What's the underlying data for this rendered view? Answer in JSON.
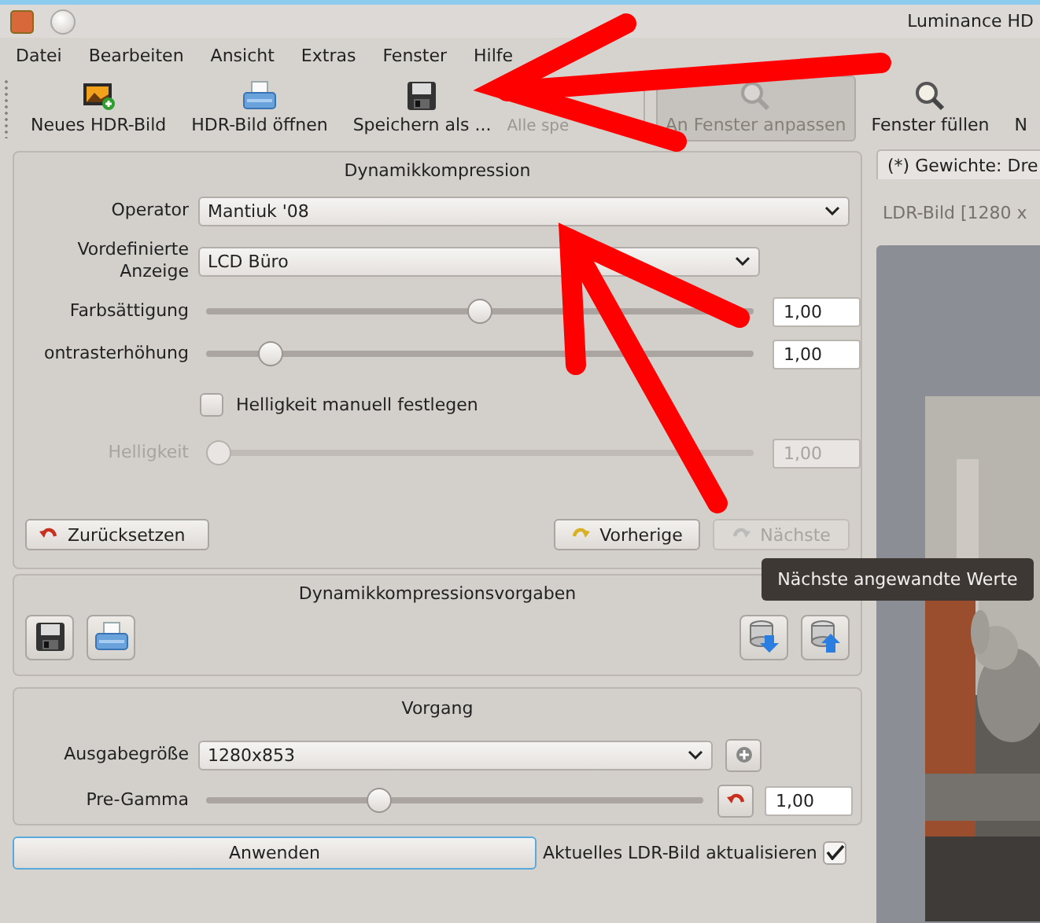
{
  "window": {
    "title": "Luminance HD"
  },
  "menu": [
    "Datei",
    "Bearbeiten",
    "Ansicht",
    "Extras",
    "Fenster",
    "Hilfe"
  ],
  "toolbar": [
    {
      "kind": "new-image",
      "label": "Neues HDR-Bild",
      "disabled": false,
      "selected": false
    },
    {
      "kind": "open",
      "label": "HDR-Bild öffnen",
      "disabled": false,
      "selected": false
    },
    {
      "kind": "save",
      "label": "Speichern als ...",
      "disabled": false,
      "selected": false
    },
    {
      "kind": "save-all",
      "label": "Alle spe",
      "disabled": true,
      "selected": false
    },
    {
      "kind": "fit",
      "label": "An Fenster anpassen",
      "disabled": true,
      "selected": true
    },
    {
      "kind": "fill",
      "label": "Fenster füllen",
      "disabled": false,
      "selected": false
    },
    {
      "kind": "text",
      "label": "N",
      "disabled": false,
      "selected": false
    }
  ],
  "tone_mapping": {
    "title": "Dynamikkompression",
    "operator": {
      "label": "Operator",
      "value": "Mantiuk '08"
    },
    "display": {
      "label": "Vordefinierte Anzeige",
      "value": "LCD Büro"
    },
    "controls": [
      {
        "kind": "slider",
        "label": "Farbsättigung",
        "level": 0.5,
        "value": "1,00",
        "disabled": false
      },
      {
        "kind": "slider",
        "label": "ontrasterhöhung",
        "level": 0.1,
        "value": "1,00",
        "disabled": false
      },
      {
        "kind": "checkbox",
        "label": "Helligkeit manuell festlegen",
        "checked": false
      },
      {
        "kind": "slider",
        "label": "Helligkeit",
        "level": 0,
        "value": "1,00",
        "disabled": true
      }
    ],
    "buttons": [
      {
        "kind": "reset",
        "label": "Zurücksetzen",
        "disabled": false
      },
      {
        "kind": "previous",
        "label": "Vorherige",
        "disabled": false
      },
      {
        "kind": "next",
        "label": "Nächste",
        "disabled": true
      }
    ]
  },
  "presets": {
    "title": "Dynamikkompressionsvorgaben",
    "buttons": [
      {
        "kind": "save"
      },
      {
        "kind": "open"
      },
      {
        "kind": "load"
      },
      {
        "kind": "export"
      }
    ]
  },
  "process": {
    "title": "Vorgang",
    "output_size": {
      "label": "Ausgabegröße",
      "value": "1280x853"
    },
    "pre_gamma": {
      "label": "Pre-Gamma",
      "level": 0.34,
      "value": "1,00"
    }
  },
  "apply_button": "Anwenden",
  "update_current": {
    "label": "Aktuelles LDR-Bild aktualisieren",
    "checked": true
  },
  "tabs": [
    {
      "label": "(*) Gewichte: Dre",
      "selected": true
    }
  ],
  "preview": {
    "label": "LDR-Bild [1280 x",
    "kind": "picture"
  },
  "tooltip": "Nächste angewandte Werte"
}
